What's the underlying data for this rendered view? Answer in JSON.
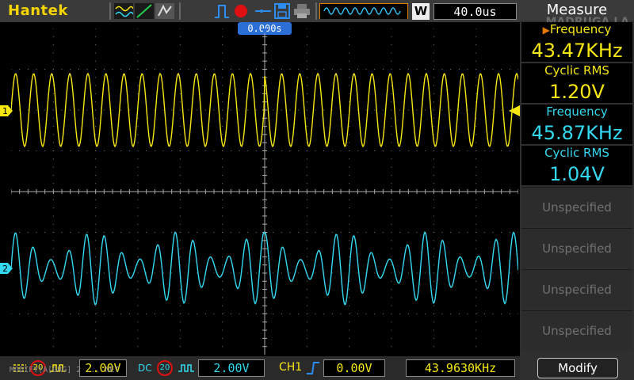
{
  "brand": "Hantek",
  "toolbar": {
    "icons": [
      "waveform-display-icon",
      "ramp-icon",
      "persistence-icon",
      "pulse-icon",
      "record-icon",
      "save-icon",
      "print-icon",
      "memory-depth-icon"
    ],
    "w_label": "W",
    "time_div": "40.0us"
  },
  "trigger_position": "0.000s",
  "colors": {
    "ch1": "#f5e614",
    "ch2": "#33d9f0",
    "grid": "#7a7a7a",
    "topbar": "#3a3a3a"
  },
  "channels": [
    {
      "id": "1",
      "marker": "1"
    },
    {
      "id": "2",
      "marker": "2"
    }
  ],
  "bottom": {
    "ch1_coupling": "20",
    "ch1_volts": "2.00V",
    "ch2_coupling": "DC",
    "ch2_bw": "20",
    "ch2_volts": "2.00V",
    "trigger_source": "CH1",
    "trigger_level": "0.00V",
    "trigger_freq": "43.9630KHz",
    "watermark": "MODIFY(A[GRG] 2 ... NET"
  },
  "measure": {
    "title": "Measure",
    "watermark": "MADRUGA LA",
    "slots": [
      {
        "name": "Frequency",
        "value": "43.47KHz",
        "color": "#f5e614",
        "selected": true
      },
      {
        "name": "Cyclic RMS",
        "value": "1.20V",
        "color": "#f5e614",
        "selected": false
      },
      {
        "name": "Frequency",
        "value": "45.87KHz",
        "color": "#33d9f0",
        "selected": false
      },
      {
        "name": "Cyclic RMS",
        "value": "1.04V",
        "color": "#33d9f0",
        "selected": false
      }
    ],
    "unspecified": [
      "Unspecified",
      "Unspecified",
      "Unspecified",
      "Unspecified"
    ],
    "modify_label": "Modify"
  }
}
